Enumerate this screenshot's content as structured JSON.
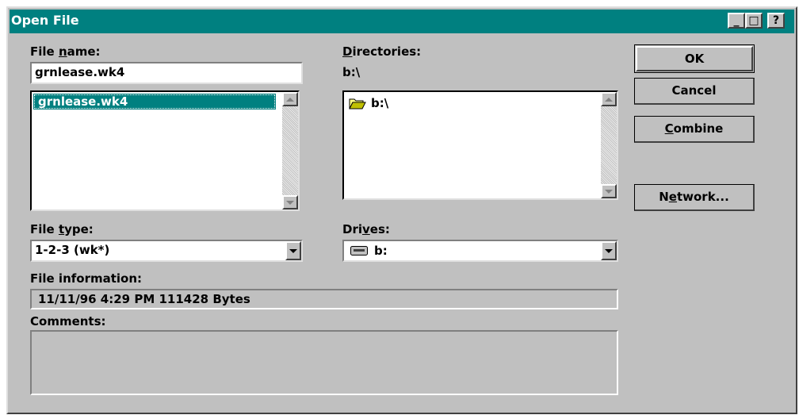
{
  "window": {
    "title": "Open File",
    "minimize_glyph": "_",
    "maximize_glyph": "□",
    "help_glyph": "?"
  },
  "file_name": {
    "label_pre": "File ",
    "label_accel": "n",
    "label_post": "ame:",
    "value": "grnlease.wk4",
    "files": [
      "grnlease.wk4"
    ]
  },
  "directories": {
    "label_pre": "",
    "label_accel": "D",
    "label_post": "irectories:",
    "current_path": "b:\\",
    "items": [
      {
        "label": "b:\\",
        "icon": "open-folder-icon"
      }
    ]
  },
  "buttons": {
    "ok": "OK",
    "cancel": "Cancel",
    "combine_accel": "C",
    "combine_post": "ombine",
    "network_pre": "N",
    "network_accel": "e",
    "network_post": "twork..."
  },
  "file_type": {
    "label_pre": "File ",
    "label_accel": "t",
    "label_post": "ype:",
    "selected": "1-2-3 (wk*)"
  },
  "drives": {
    "label_pre": "Dri",
    "label_accel": "v",
    "label_post": "es:",
    "selected": "b:",
    "icon": "floppy-drive-icon"
  },
  "file_information": {
    "label": "File information:",
    "value": "11/11/96   4:29 PM   111428 Bytes"
  },
  "comments": {
    "label": "Comments:",
    "value": ""
  },
  "colors": {
    "title_bar": "#008080",
    "face": "#c0c0c0",
    "selection": "#008080"
  }
}
